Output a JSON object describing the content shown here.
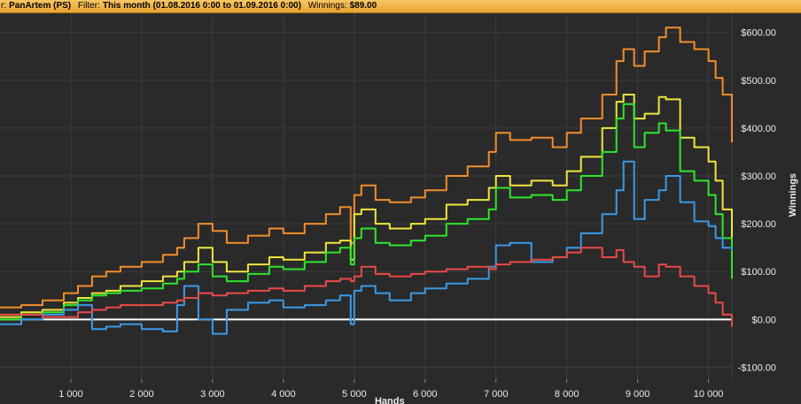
{
  "header": {
    "player_label": "r:",
    "player_value": "PanArtem (PS)",
    "filter_label": "Filter:",
    "filter_value": "This month (01.08.2016 0:00 to 01.09.2016 0:00)",
    "winnings_label": "Winnings:",
    "winnings_value": "$89.00"
  },
  "chart_data": {
    "type": "line",
    "xlabel": "Hands",
    "ylabel": "Winnings",
    "xlim": [
      0,
      10330
    ],
    "ylim": [
      -125,
      640
    ],
    "x_ticks": [
      1000,
      2000,
      3000,
      4000,
      5000,
      6000,
      7000,
      8000,
      9000,
      10000
    ],
    "x_tick_labels": [
      "1 000",
      "2 000",
      "3 000",
      "4 000",
      "5 000",
      "6 000",
      "7 000",
      "8 000",
      "9 000",
      "10 000"
    ],
    "y_ticks": [
      -100,
      0,
      100,
      200,
      300,
      400,
      500,
      600
    ],
    "y_tick_labels": [
      "-$100.00",
      "$0.00",
      "$100.00",
      "$200.00",
      "$300.00",
      "$400.00",
      "$500.00",
      "$600.00"
    ],
    "grid": true,
    "zero_line": true,
    "colors": {
      "background": "#2a2a2a",
      "grid": "#3d3d3d",
      "zero_line": "#ffffff"
    },
    "series": [
      {
        "color": "#f28e2c",
        "x": [
          0,
          300,
          600,
          900,
          1100,
          1300,
          1500,
          1700,
          2000,
          2300,
          2500,
          2600,
          2800,
          3000,
          3200,
          3500,
          3800,
          4000,
          4300,
          4600,
          4800,
          4950,
          5000,
          5100,
          5300,
          5500,
          5800,
          6000,
          6300,
          6600,
          6900,
          7000,
          7200,
          7500,
          7800,
          8000,
          8200,
          8500,
          8700,
          8800,
          8950,
          9100,
          9300,
          9400,
          9600,
          9800,
          10000,
          10100,
          10200,
          10330
        ],
        "values": [
          25,
          30,
          40,
          55,
          70,
          90,
          100,
          110,
          120,
          135,
          150,
          170,
          200,
          185,
          160,
          175,
          190,
          180,
          200,
          220,
          235,
          160,
          260,
          280,
          250,
          245,
          255,
          270,
          300,
          320,
          350,
          390,
          375,
          380,
          360,
          390,
          420,
          470,
          540,
          565,
          530,
          560,
          590,
          610,
          580,
          565,
          540,
          505,
          470,
          370
        ]
      },
      {
        "color": "#f0e63e",
        "x": [
          0,
          300,
          600,
          900,
          1100,
          1300,
          1500,
          1700,
          2000,
          2300,
          2500,
          2600,
          2800,
          3000,
          3200,
          3500,
          3800,
          4000,
          4300,
          4600,
          4800,
          4950,
          5000,
          5100,
          5300,
          5500,
          5800,
          6000,
          6300,
          6600,
          6900,
          7000,
          7200,
          7500,
          7800,
          8000,
          8200,
          8500,
          8700,
          8800,
          8950,
          9100,
          9300,
          9400,
          9600,
          9800,
          10000,
          10100,
          10200,
          10330
        ],
        "values": [
          5,
          15,
          20,
          35,
          45,
          55,
          60,
          70,
          80,
          90,
          100,
          120,
          150,
          120,
          100,
          115,
          130,
          125,
          140,
          160,
          165,
          125,
          220,
          230,
          200,
          190,
          200,
          210,
          240,
          250,
          275,
          300,
          280,
          290,
          280,
          310,
          340,
          400,
          455,
          470,
          420,
          430,
          465,
          460,
          380,
          360,
          330,
          290,
          230,
          140
        ]
      },
      {
        "color": "#2ee62e",
        "x": [
          0,
          300,
          600,
          900,
          1100,
          1300,
          1500,
          1700,
          2000,
          2300,
          2500,
          2600,
          2800,
          3000,
          3200,
          3500,
          3800,
          4000,
          4300,
          4600,
          4800,
          4950,
          5000,
          5100,
          5300,
          5500,
          5800,
          6000,
          6300,
          6600,
          6900,
          7000,
          7200,
          7500,
          7800,
          8000,
          8200,
          8500,
          8700,
          8800,
          8950,
          9100,
          9300,
          9400,
          9600,
          9800,
          10000,
          10100,
          10200,
          10330
        ],
        "values": [
          0,
          10,
          15,
          30,
          40,
          50,
          55,
          60,
          65,
          75,
          85,
          100,
          115,
          90,
          80,
          95,
          110,
          105,
          120,
          140,
          150,
          115,
          170,
          190,
          160,
          155,
          165,
          175,
          200,
          210,
          230,
          275,
          255,
          260,
          250,
          270,
          300,
          350,
          420,
          450,
          360,
          390,
          410,
          395,
          310,
          290,
          260,
          220,
          170,
          85
        ]
      },
      {
        "color": "#3b9ae8",
        "x": [
          0,
          300,
          600,
          900,
          1100,
          1300,
          1500,
          1700,
          2000,
          2300,
          2500,
          2600,
          2800,
          3000,
          3200,
          3500,
          3800,
          4000,
          4300,
          4600,
          4800,
          4950,
          5000,
          5100,
          5300,
          5500,
          5800,
          6000,
          6300,
          6600,
          6900,
          7000,
          7200,
          7500,
          7800,
          8000,
          8200,
          8500,
          8700,
          8800,
          8950,
          9100,
          9300,
          9400,
          9600,
          9800,
          10000,
          10100,
          10200,
          10330
        ],
        "values": [
          -10,
          0,
          10,
          20,
          30,
          -20,
          -15,
          -10,
          -20,
          -25,
          30,
          70,
          0,
          -30,
          20,
          35,
          40,
          25,
          30,
          40,
          50,
          -10,
          60,
          70,
          55,
          40,
          55,
          65,
          75,
          85,
          110,
          155,
          160,
          120,
          130,
          150,
          180,
          220,
          270,
          330,
          210,
          250,
          270,
          300,
          245,
          205,
          195,
          170,
          150,
          145
        ]
      },
      {
        "color": "#e94a48",
        "x": [
          0,
          300,
          600,
          900,
          1100,
          1300,
          1500,
          1700,
          2000,
          2300,
          2500,
          2600,
          2800,
          3000,
          3200,
          3500,
          3800,
          4000,
          4300,
          4600,
          4800,
          4950,
          5000,
          5100,
          5300,
          5500,
          5800,
          6000,
          6300,
          6600,
          6900,
          7000,
          7200,
          7500,
          7800,
          8000,
          8200,
          8500,
          8700,
          8800,
          8950,
          9100,
          9300,
          9400,
          9600,
          9800,
          10000,
          10100,
          10200,
          10330
        ],
        "values": [
          10,
          10,
          5,
          5,
          15,
          20,
          25,
          30,
          30,
          35,
          40,
          45,
          55,
          50,
          55,
          60,
          65,
          60,
          70,
          80,
          85,
          80,
          90,
          110,
          95,
          90,
          95,
          100,
          105,
          110,
          105,
          115,
          120,
          125,
          130,
          140,
          150,
          130,
          145,
          120,
          110,
          90,
          115,
          110,
          90,
          70,
          55,
          35,
          10,
          -15
        ]
      }
    ]
  }
}
